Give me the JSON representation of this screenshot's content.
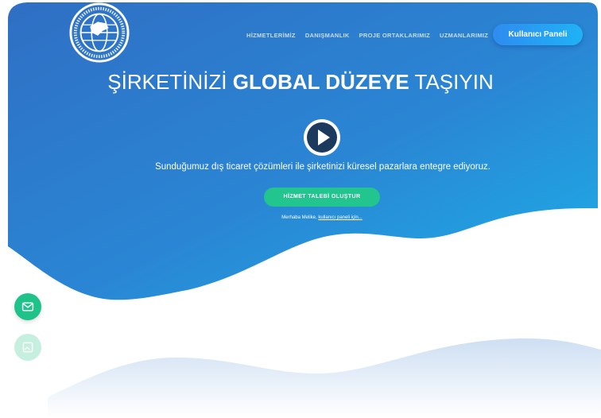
{
  "colors": {
    "hero_top": "#2f76c9",
    "hero_bottom": "#1f9ad8",
    "accent_green": "#22c58d",
    "button_blue": "#2f8cf0"
  },
  "logo": {
    "ring_text": "TÜRKİYE DIŞ TİCARET İSTİHBARAT MERKEZİ",
    "icon": "globe-logo"
  },
  "nav": {
    "items": [
      {
        "label": "HİZMETLERİMİZ"
      },
      {
        "label": "DANIŞMANLIK"
      },
      {
        "label": "PROJE ORTAKLARIMIZ"
      },
      {
        "label": "UZMANLARIMIZ"
      }
    ],
    "panel_button": "Kullanıcı Paneli"
  },
  "hero": {
    "headline_part1": "ŞİRKETİNİZİ",
    "headline_bold": "GLOBAL DÜZEYE",
    "headline_part2": "TAŞIYIN",
    "subtitle": "Sunduğumuz dış ticaret çözümleri ile şirketinizi küresel pazarlara entegre ediyoruz.",
    "cta": "HİZMET TALEBİ OLUŞTUR",
    "greeting_prefix": "Merhaba Melike,",
    "greeting_link": "kullanıcı paneli için..."
  },
  "floating": {
    "mail_icon": "mail-icon",
    "secondary_icon": "image-icon"
  }
}
